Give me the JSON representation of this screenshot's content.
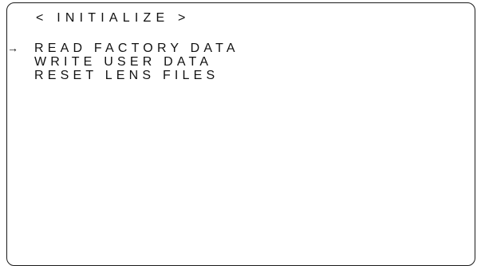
{
  "menu": {
    "title": "< INITIALIZE >",
    "cursor": "→",
    "items": [
      {
        "label": "READ FACTORY DATA",
        "selected": true
      },
      {
        "label": "WRITE USER DATA",
        "selected": false
      },
      {
        "label": "RESET LENS FILES",
        "selected": false
      }
    ]
  }
}
